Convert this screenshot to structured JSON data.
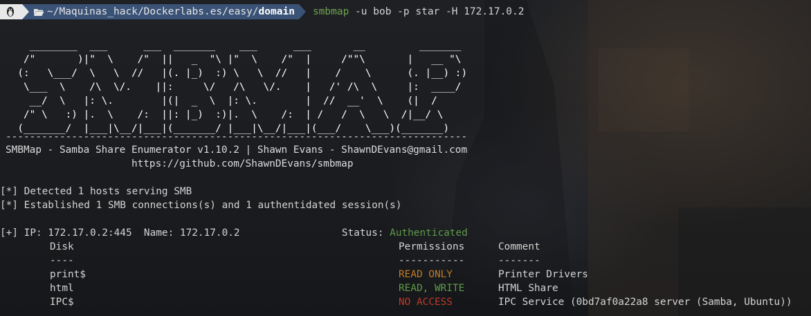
{
  "prompt": {
    "os_icon": "linux-tux-icon",
    "folder_icon": "folder-open-icon",
    "path_prefix": "~/Maquinas_hack/Dockerlabs.es/easy/",
    "path_current": "domain",
    "command_program": "smbmap",
    "command_args": " -u bob -p star -H 172.17.0.2"
  },
  "banner": [
    "    ________  ___      ___  _______    ___      ___       __         _______",
    "   /\"       )|\"  \\    /\"  ||   _  \"\\ |\"  \\    /\"  |     /\"\"\\       |   __ \"\\",
    "  (:   \\___/  \\   \\  //   |(. |_)  :) \\   \\  //   |    /    \\      (. |__) :)",
    "   \\___  \\    /\\  \\/.    ||:     \\/   /\\   \\/.    |   /' /\\  \\     |:  ____/",
    "    __/  \\   |: \\.        |(|  _  \\  |: \\.        |  //  __'  \\    (|  /",
    "   /\" \\   :) |.  \\    /:  ||: |_)  :)|.  \\    /:  | /   /  \\   \\  /|__/ \\",
    "  (_______/  |___|\\__/|___|(_______/ |___|\\__/|___|(___/    \\___)(_______)"
  ],
  "separator": "-----------------------------------------------------------------------------",
  "header_line": "SMBMap - Samba Share Enumerator v1.10.2 | Shawn Evans - ShawnDEvans@gmail.com",
  "url_line": "                     https://github.com/ShawnDEvans/smbmap",
  "status": {
    "detected": "[*] Detected 1 hosts serving SMB",
    "established": "[*] Established 1 SMB connections(s) and 1 authentidated session(s)"
  },
  "host": {
    "prefix": "[+] IP: 172.17.0.2:445  Name: 172.17.0.2                 Status: ",
    "status_value": "Authenticated"
  },
  "table": {
    "col_disk": "Disk",
    "col_permissions": "Permissions",
    "col_comment": "Comment",
    "dash_disk": "----",
    "dash_permissions": "-----------",
    "dash_comment": "-------",
    "rows": [
      {
        "disk": "print$",
        "permission": "READ ONLY",
        "comment": "Printer Drivers",
        "perm_color": "#c07a2a"
      },
      {
        "disk": "html",
        "permission": "READ, WRITE",
        "comment": "HTML Share",
        "perm_color": "#5f9a4a"
      },
      {
        "disk": "IPC$",
        "permission": "NO ACCESS",
        "comment": "IPC Service (0bd7af0a22a8 server (Samba, Ubuntu))",
        "perm_color": "#c0392b"
      }
    ]
  }
}
